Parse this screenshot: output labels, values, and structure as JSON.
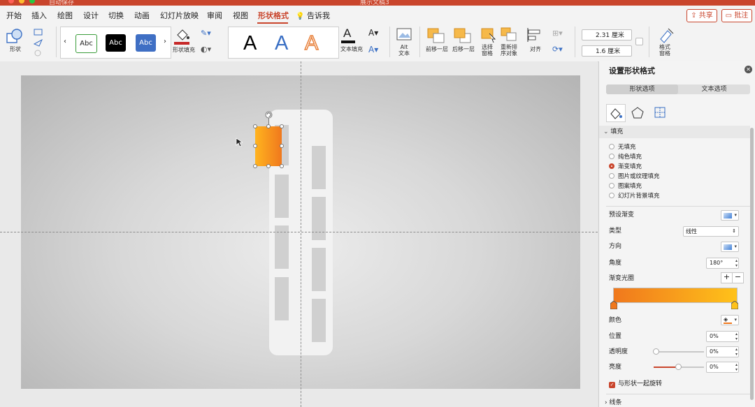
{
  "window": {
    "title": "展示文稿3",
    "autosave_label": "自动保存"
  },
  "tabs": [
    "开始",
    "插入",
    "绘图",
    "设计",
    "切换",
    "动画",
    "幻灯片放映",
    "审阅",
    "视图",
    "形状格式"
  ],
  "tell_me": "告诉我",
  "header_buttons": {
    "share": "共享",
    "comments": "批注"
  },
  "ribbon": {
    "shape_label": "形状",
    "style_presets": [
      "Abc",
      "Abc",
      "Abc"
    ],
    "shape_fill_label": "形状填充",
    "wordart_letters": [
      "A",
      "A",
      "A"
    ],
    "text_fill_label": "文本填充",
    "alt_text_label": "Alt\n文本",
    "bring_forward_label": "前移一层",
    "send_backward_label": "后移一层",
    "selection_pane_label": "选择\n窗格",
    "reorder_label": "重新排\n序对象",
    "align_label": "对齐",
    "height_value": "2.31 厘米",
    "width_value": "1.6 厘米",
    "format_pane_label": "格式\n窗格",
    "accent_color": "#c9452c"
  },
  "panel": {
    "title": "设置形状格式",
    "tabs": [
      "形状选项",
      "文本选项"
    ],
    "fill_section": "填充",
    "fill_options": [
      "无填充",
      "纯色填充",
      "渐变填充",
      "图片或纹理填充",
      "图案填充",
      "幻灯片背景填充"
    ],
    "selected_fill": "渐变填充",
    "preset_gradient_label": "预设渐变",
    "type_label": "类型",
    "type_value": "线性",
    "direction_label": "方向",
    "angle_label": "角度",
    "angle_value": "180°",
    "gradient_stops_label": "渐变光圈",
    "color_label": "颜色",
    "position_label": "位置",
    "position_value": "0%",
    "transparency_label": "透明度",
    "transparency_value": "0%",
    "brightness_label": "亮度",
    "brightness_value": "0%",
    "rotate_with_shape_label": "与形状一起旋转",
    "line_section": "线条",
    "gradient_colors": [
      "#f0781d",
      "#ffc21a"
    ]
  }
}
